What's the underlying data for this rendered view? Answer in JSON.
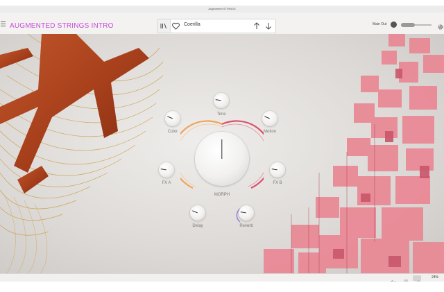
{
  "window_title": "Augmented STRINGS",
  "toolbar": {
    "preset_title": "AUGMENTED STRINGS INTRO",
    "preset_name": "Coerilla",
    "main_out_label": "Main Out"
  },
  "knobs": {
    "time": {
      "label": "Time",
      "value": 0.2
    },
    "color": {
      "label": "Color",
      "value": 0.25
    },
    "motion": {
      "label": "Motion",
      "value": 0.25
    },
    "fxa": {
      "label": "FX A",
      "value": 0.2
    },
    "fxb": {
      "label": "FX B",
      "value": 0.2
    },
    "delay": {
      "label": "Delay",
      "value": 0.25
    },
    "reverb": {
      "label": "Reverb",
      "value": 0.2
    },
    "morph": {
      "label": "MORPH",
      "value": 0.5
    }
  },
  "main_out_level": 0.45,
  "status": {
    "zoom": "24%"
  },
  "colors": {
    "accent": "#c64bd9",
    "morph_ring_left": "#f0a35a",
    "morph_ring_right": "#d9506a",
    "reverb_ring": "#8a7bd8"
  },
  "icons": [
    "menu-icon",
    "library-icon",
    "heart-icon",
    "arrow-up-icon",
    "arrow-down-icon",
    "speaker-knob-icon",
    "gear-icon",
    "undo-icon",
    "list-icon",
    "redo-icon"
  ]
}
